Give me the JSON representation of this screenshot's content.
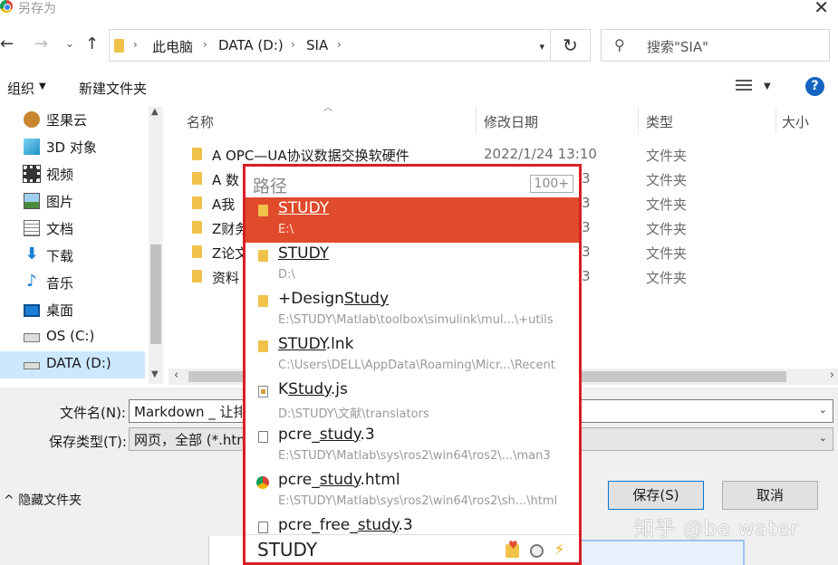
{
  "window": {
    "title": "另存为",
    "close_glyph": "✕"
  },
  "nav": {
    "back_glyph": "←",
    "forward_glyph": "→",
    "dropdown_glyph": "⌄",
    "up_glyph": "↑",
    "breadcrumb": [
      "此电脑",
      "DATA (D:)",
      "SIA"
    ],
    "separator_glyph": "›",
    "refresh_glyph": "↻",
    "search_icon_glyph": "⚲",
    "search_placeholder": "搜索\"SIA\""
  },
  "toolbar": {
    "organize": "组织",
    "new_folder": "新建文件夹",
    "help": "?"
  },
  "sidebar": {
    "items": [
      {
        "label": "坚果云",
        "icon": "nut-icon"
      },
      {
        "label": "3D 对象",
        "icon": "cube-icon"
      },
      {
        "label": "视频",
        "icon": "film-icon"
      },
      {
        "label": "图片",
        "icon": "picture-icon"
      },
      {
        "label": "文档",
        "icon": "document-icon"
      },
      {
        "label": "下载",
        "icon": "download-icon"
      },
      {
        "label": "音乐",
        "icon": "music-icon"
      },
      {
        "label": "桌面",
        "icon": "desktop-icon"
      },
      {
        "label": "OS (C:)",
        "icon": "drive-icon"
      },
      {
        "label": "DATA (D:)",
        "icon": "drive-icon",
        "selected": true
      }
    ]
  },
  "columns": {
    "name": "名称",
    "date": "修改日期",
    "type": "类型",
    "size": "大小"
  },
  "files": [
    {
      "name": "A OPC—UA协议数据交换软硬件",
      "date": "2022/1/24 13:10",
      "type": "文件夹"
    },
    {
      "name": "A 数",
      "date": "3",
      "type": "文件夹"
    },
    {
      "name": "A我",
      "date": "3",
      "type": "文件夹"
    },
    {
      "name": "Z财务",
      "date": "3",
      "type": "文件夹"
    },
    {
      "name": "Z论文",
      "date": "3",
      "type": "文件夹"
    },
    {
      "name": "资料",
      "date": "3",
      "type": "文件夹"
    }
  ],
  "bottom": {
    "filename_label": "文件名(N):",
    "filename_value": "Markdown _ 让排",
    "filetype_label": "保存类型(T):",
    "filetype_value": "网页，全部 (*.htm",
    "hide_folders": "隐藏文件夹",
    "save": "保存(S)",
    "cancel": "取消",
    "watermark": "知乎 @be water"
  },
  "popup": {
    "header": "路径",
    "count": "100+",
    "query": "STUDY",
    "results": [
      {
        "pre": "",
        "match": "STUDY",
        "post": "",
        "path": "E:\\",
        "icon": "folder",
        "active": true
      },
      {
        "pre": "",
        "match": "STUDY",
        "post": "",
        "path": "D:\\",
        "icon": "folder"
      },
      {
        "pre": "+Design",
        "match": "Study",
        "post": "",
        "path": "E:\\STUDY\\Matlab\\toolbox\\simulink\\mul...\\+utils",
        "icon": "folder"
      },
      {
        "pre": "",
        "match": "STUDY",
        "post": ".lnk",
        "path": "C:\\Users\\DELL\\AppData\\Roaming\\Micr...\\Recent",
        "icon": "folder"
      },
      {
        "pre": "K",
        "match": "Study",
        "post": ".js",
        "path": "D:\\STUDY\\文献\\translators",
        "icon": "js"
      },
      {
        "pre": "pcre_",
        "match": "study",
        "post": ".3",
        "path": "E:\\STUDY\\Matlab\\sys\\ros2\\win64\\ros2\\...\\man3",
        "icon": "doc"
      },
      {
        "pre": "pcre_",
        "match": "study",
        "post": ".html",
        "path": "E:\\STUDY\\Matlab\\sys\\ros2\\win64\\ros2\\sh...\\html",
        "icon": "chrome"
      },
      {
        "pre": "pcre_free_",
        "match": "study",
        "post": ".3",
        "path": "",
        "icon": "doc"
      }
    ]
  }
}
